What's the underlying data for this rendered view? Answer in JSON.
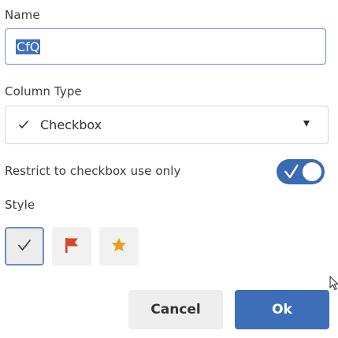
{
  "name_field": {
    "label": "Name",
    "value": "CfQ"
  },
  "column_type": {
    "label": "Column Type",
    "selected": "Checkbox",
    "selected_icon": "check-icon"
  },
  "restrict": {
    "label": "Restrict to checkbox use only",
    "enabled": true
  },
  "style": {
    "label": "Style",
    "options": [
      {
        "icon": "check-icon",
        "selected": true
      },
      {
        "icon": "flag-icon",
        "selected": false,
        "color": "#d8452b"
      },
      {
        "icon": "star-icon",
        "selected": false,
        "color": "#e6a01c"
      }
    ]
  },
  "actions": {
    "cancel_label": "Cancel",
    "ok_label": "Ok"
  },
  "colors": {
    "accent": "#3d6eb8",
    "flag": "#d8452b",
    "star": "#e6a01c"
  }
}
